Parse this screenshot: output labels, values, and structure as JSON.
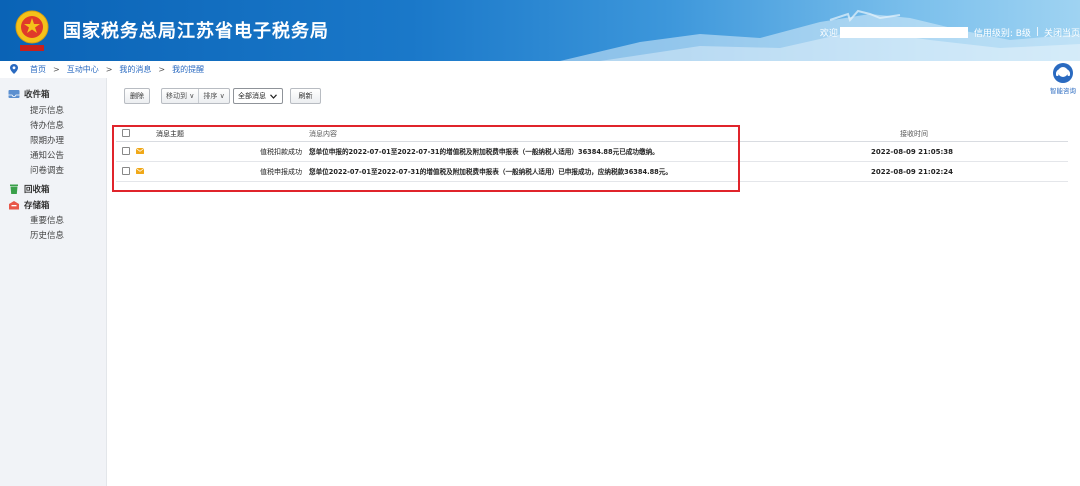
{
  "header": {
    "title": "国家税务总局江苏省电子税务局",
    "welcome": "欢迎",
    "credit_label": "信用级别: B级",
    "close_label": "关闭当页",
    "divider": "|"
  },
  "breadcrumb": {
    "items": [
      "首页",
      "互动中心",
      "我的消息",
      "我的提醒"
    ],
    "separator": ">"
  },
  "sidebar": {
    "groups": [
      {
        "label": "收件箱",
        "icon": "inbox-icon",
        "items": [
          "提示信息",
          "待办信息",
          "限期办理",
          "通知公告",
          "问卷调查"
        ]
      },
      {
        "label": "回收箱",
        "icon": "trash-icon",
        "items": []
      },
      {
        "label": "存储箱",
        "icon": "storage-box-icon",
        "items": [
          "重要信息",
          "历史信息"
        ]
      }
    ]
  },
  "toolbar": {
    "delete_label": "删除",
    "move_label": "移动到 ∨",
    "sort_label": "排序 ∨",
    "filter_value": "全部消息",
    "refresh_label": "刷新"
  },
  "table": {
    "headers": {
      "subject": "消息主题",
      "content": "消息内容",
      "time": "接收时间"
    },
    "rows": [
      {
        "subject": "值税扣款成功",
        "content": "您单位申报的2022-07-01至2022-07-31的增值税及附加税费申报表（一般纳税人适用）36384.88元已成功缴纳。",
        "time": "2022-08-09 21:05:38"
      },
      {
        "subject": "值税申报成功",
        "content": "您单位2022-07-01至2022-07-31的增值税及附加税费申报表（一般纳税人适用）已申报成功，应纳税款36384.88元。",
        "time": "2022-08-09 21:02:24"
      }
    ]
  },
  "smart_consult": {
    "label": "智能咨询"
  },
  "colors": {
    "header_blue": "#1a78c9",
    "highlight_red": "#e0242b",
    "link_blue": "#2a6ac0",
    "mail_yellow": "#f0a818"
  }
}
